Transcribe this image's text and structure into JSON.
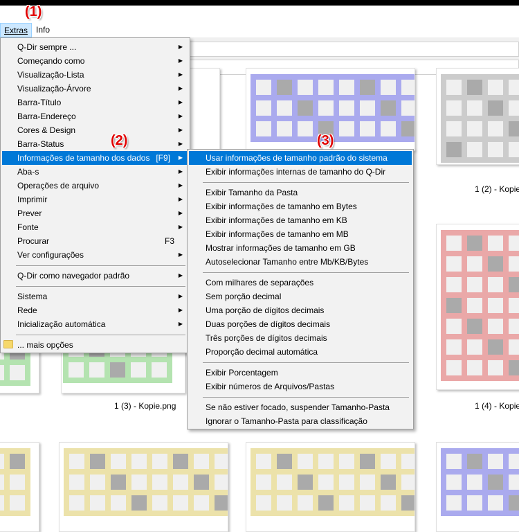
{
  "menubar": {
    "items": [
      {
        "label": "Extras",
        "active": true
      },
      {
        "label": "Info",
        "active": false
      }
    ]
  },
  "menu": {
    "items": [
      {
        "label": "Q-Dir sempre ...",
        "submenu": true
      },
      {
        "label": "Começando como",
        "submenu": true
      },
      {
        "label": "Visualização-Lista",
        "submenu": true
      },
      {
        "label": "Visualização-Árvore",
        "submenu": true
      },
      {
        "label": "Barra-Título",
        "submenu": true
      },
      {
        "label": "Barra-Endereço",
        "submenu": true
      },
      {
        "label": "Cores & Design",
        "submenu": true
      },
      {
        "label": "Barra-Status",
        "submenu": true
      },
      {
        "label": "Informações de tamanho dos dados",
        "shortcut": "[F9]",
        "submenu": true,
        "highlighted": true
      },
      {
        "label": "Aba-s",
        "submenu": true
      },
      {
        "label": "Operações de arquivo",
        "submenu": true
      },
      {
        "label": "Imprimir",
        "submenu": true
      },
      {
        "label": "Prever",
        "submenu": true
      },
      {
        "label": "Fonte",
        "submenu": true
      },
      {
        "label": "Procurar",
        "shortcut": "F3",
        "submenu": false
      },
      {
        "label": "Ver configurações",
        "submenu": true
      },
      {
        "label": "Q-Dir como navegador padrão",
        "submenu": true
      },
      {
        "label": "Sistema",
        "submenu": true
      },
      {
        "label": "Rede",
        "submenu": true
      },
      {
        "label": "Inicialização automática",
        "submenu": true
      },
      {
        "label": "... mais opções",
        "submenu": false,
        "icon": "folder-icon"
      }
    ]
  },
  "submenu": {
    "items": [
      {
        "label": "Usar informações de tamanho padrão do sistema",
        "highlighted": true
      },
      {
        "label": "Exibir informações internas de tamanho do Q-Dir"
      },
      {
        "label": "Exibir Tamanho da Pasta"
      },
      {
        "label": "Exibir informações de tamanho em Bytes"
      },
      {
        "label": "Exibir informações de tamanho em KB"
      },
      {
        "label": "Exibir informações de tamanho em MB"
      },
      {
        "label": "Mostrar informações de tamanho em GB"
      },
      {
        "label": "Autoselecionar Tamanho entre Mb/KB/Bytes"
      },
      {
        "label": "Com milhares de separações"
      },
      {
        "label": "Sem porção decimal"
      },
      {
        "label": "Uma porção de dígitos decimais"
      },
      {
        "label": "Duas porções de dígitos decimais"
      },
      {
        "label": "Três porções de dígitos decimais"
      },
      {
        "label": "Proporção decimal automática"
      },
      {
        "label": "Exibir Porcentagem"
      },
      {
        "label": "Exibir números de Arquivos/Pastas"
      },
      {
        "label": "Se não estiver focado, suspender Tamanho-Pasta"
      },
      {
        "label": "Ignorar o Tamanho-Pasta para classificação"
      }
    ]
  },
  "files": [
    {
      "label": "1 (2) - Kopie"
    },
    {
      "label": "1 (3) - Kopie.png"
    },
    {
      "label": "1 (4) - Kopie"
    }
  ],
  "annotations": [
    "(1)",
    "(2)",
    "(3)"
  ],
  "colors": {
    "purple": "#aaaaee",
    "gray": "#cccccc",
    "red": "#eaa8a8",
    "green": "#b4e3b0",
    "yellow": "#ece2aa",
    "cell_gray": "#aaaaaa",
    "highlight": "#0078d7"
  }
}
